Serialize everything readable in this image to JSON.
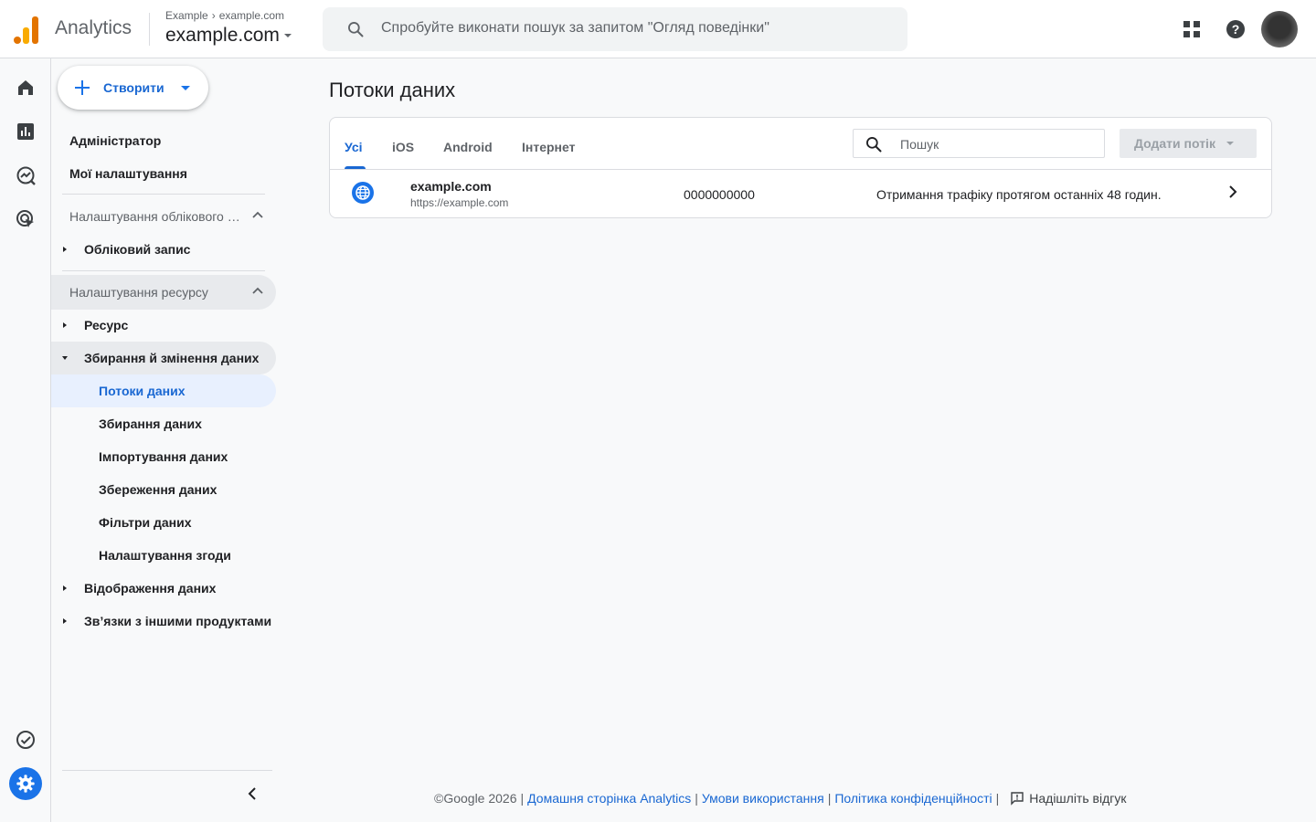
{
  "header": {
    "app_name": "Analytics",
    "breadcrumb_account": "Example",
    "breadcrumb_property": "example.com",
    "property_name": "example.com",
    "search_placeholder": "Спробуйте виконати пошук за запитом \"Огляд поведінки\""
  },
  "rail": {
    "icons": [
      "home-icon",
      "reports-icon",
      "explore-icon",
      "advertising-icon",
      "checklist-icon",
      "settings-icon"
    ],
    "accent_color": "#1a73e8"
  },
  "nav": {
    "create_label": "Створити",
    "admin_label": "Адміністратор",
    "my_settings_label": "Мої налаштування",
    "account_section_label": "Налаштування облікового запису",
    "account_item_label": "Обліковий запис",
    "property_section_label": "Налаштування ресурсу",
    "property_item_label": "Ресурс",
    "data_collection_label": "Збирання й змінення даних",
    "sub_items": [
      "Потоки даних",
      "Збирання даних",
      "Імпортування даних",
      "Збереження даних",
      "Фільтри даних",
      "Налаштування згоди"
    ],
    "data_display_label": "Відображення даних",
    "product_links_label": "Зв’язки з іншими продуктами"
  },
  "main": {
    "page_title": "Потоки даних",
    "tabs": [
      {
        "label": "Усі",
        "active": true
      },
      {
        "label": "iOS",
        "active": false
      },
      {
        "label": "Android",
        "active": false
      },
      {
        "label": "Інтернет",
        "active": false
      }
    ],
    "search_placeholder": "Пошук",
    "add_stream_label": "Додати потік",
    "streams": [
      {
        "name": "example.com",
        "url": "https://example.com",
        "id": "0000000000",
        "status": "Отримання трафіку протягом останніх 48 годин."
      }
    ]
  },
  "footer": {
    "copyright": "©Google 2026",
    "links": [
      "Домашня сторінка Analytics",
      "Умови використання",
      "Політика конфіденційності"
    ],
    "feedback_label": "Надішліть відгук",
    "separator": "|"
  }
}
